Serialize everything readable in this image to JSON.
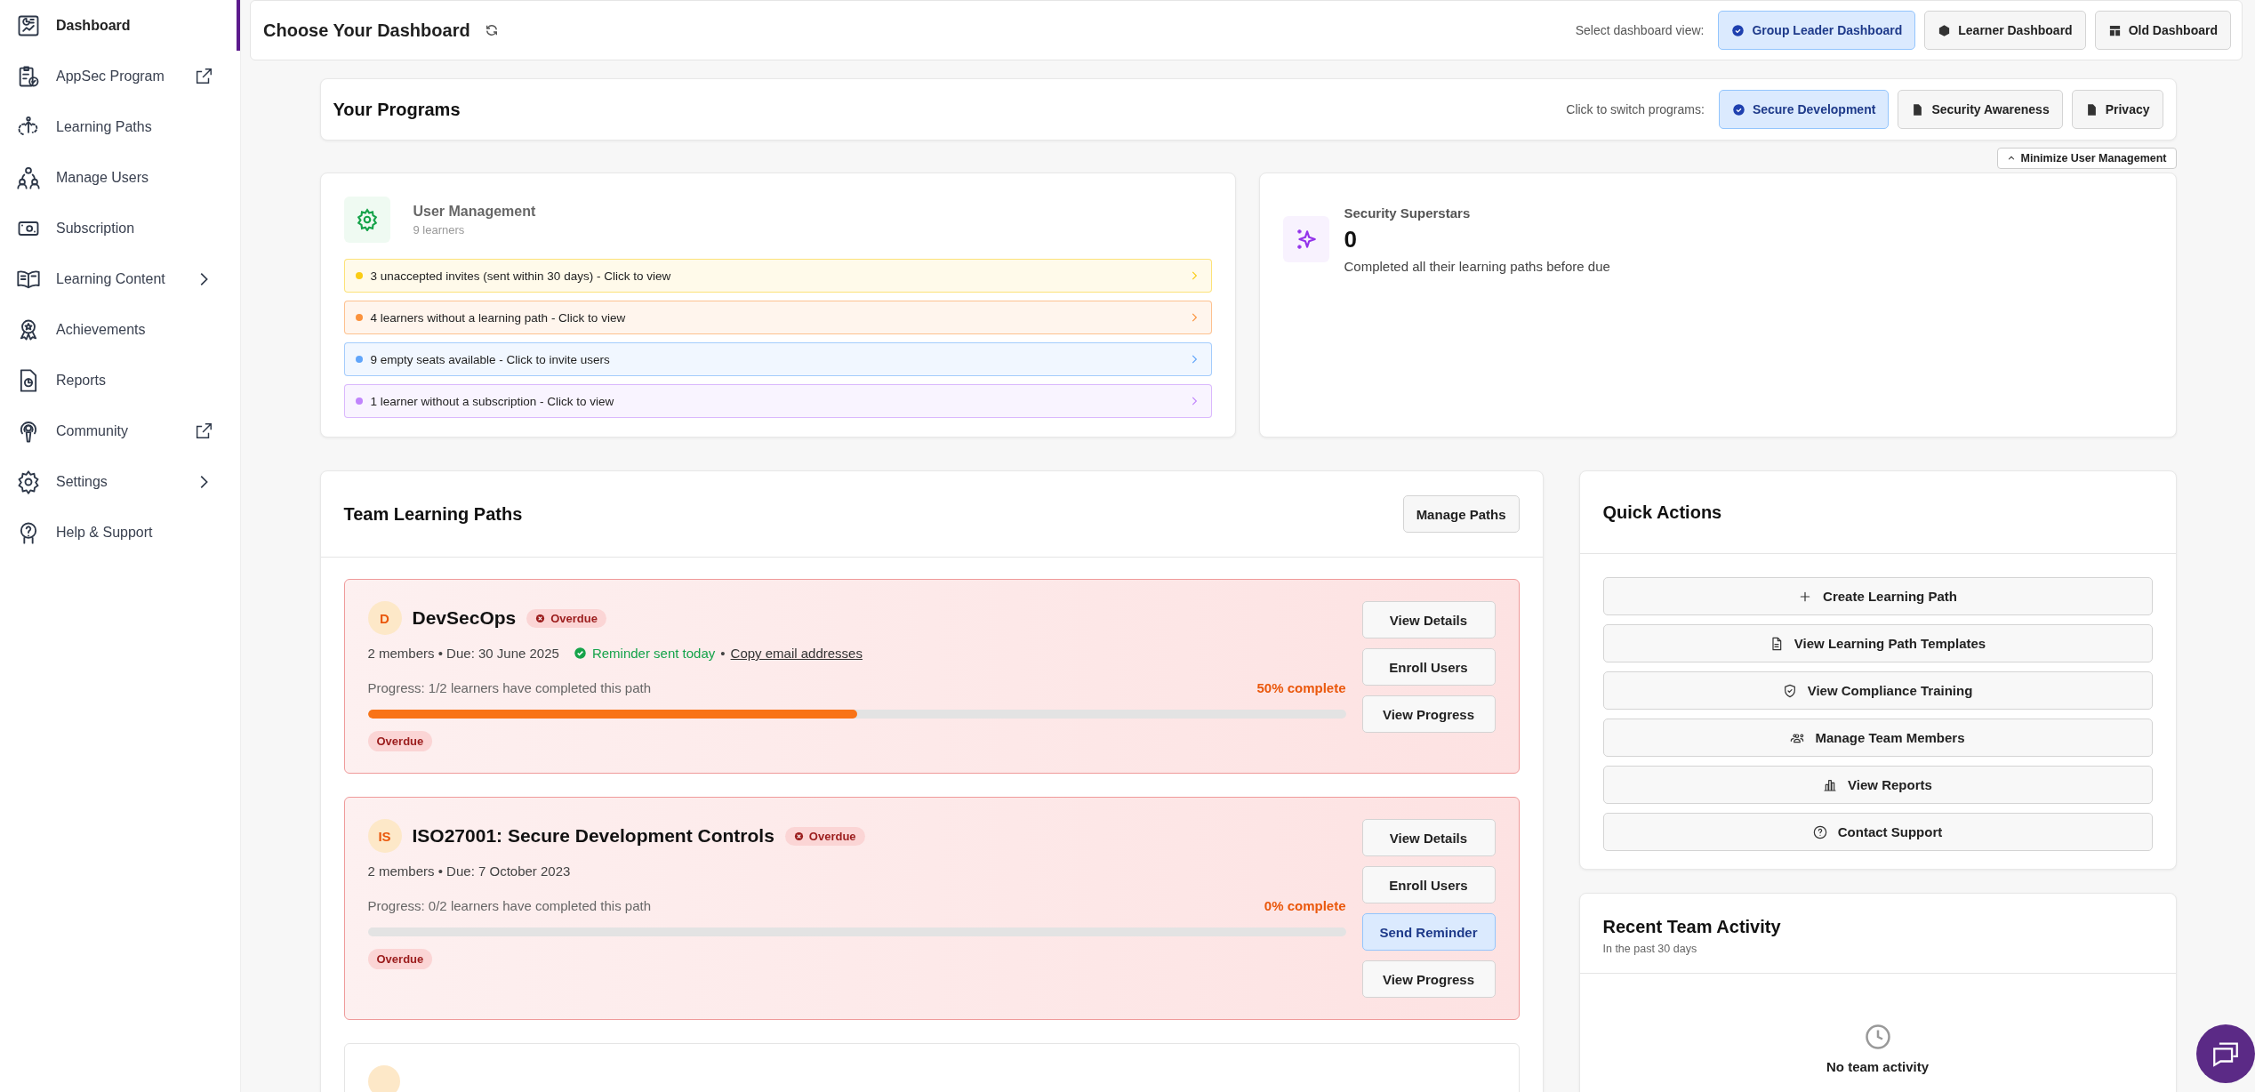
{
  "sidebar": {
    "items": [
      {
        "label": "Dashboard",
        "selected": true
      },
      {
        "label": "AppSec Program",
        "selected": false,
        "kind": "external"
      },
      {
        "label": "Learning Paths",
        "selected": false
      },
      {
        "label": "Manage Users",
        "selected": false
      },
      {
        "label": "Subscription",
        "selected": false
      },
      {
        "label": "Learning Content",
        "selected": false,
        "kind": "submenu"
      },
      {
        "label": "Achievements",
        "selected": false
      },
      {
        "label": "Reports",
        "selected": false
      },
      {
        "label": "Community",
        "selected": false,
        "kind": "external"
      },
      {
        "label": "Settings",
        "selected": false,
        "kind": "submenu"
      },
      {
        "label": "Help & Support",
        "selected": false
      }
    ]
  },
  "header": {
    "title": "Choose Your Dashboard",
    "view_label": "Select dashboard view:",
    "views": [
      {
        "label": "Group Leader Dashboard",
        "selected": true
      },
      {
        "label": "Learner Dashboard",
        "selected": false
      },
      {
        "label": "Old Dashboard",
        "selected": false
      }
    ]
  },
  "programs": {
    "title": "Your Programs",
    "switch_label": "Click to switch programs:",
    "buttons": [
      {
        "label": "Secure Development",
        "selected": true
      },
      {
        "label": "Security Awareness",
        "selected": false
      },
      {
        "label": "Privacy",
        "selected": false
      }
    ]
  },
  "minimize_button": "Minimize User Management",
  "user_management": {
    "title": "User Management",
    "subtitle": "9 learners",
    "alerts": [
      {
        "text": "3 unaccepted invites (sent within 30 days) - Click to view",
        "color": "#facc15"
      },
      {
        "text": "4 learners without a learning path - Click to view",
        "color": "#fb923c"
      },
      {
        "text": "9 empty seats available - Click to invite users",
        "color": "#60a5fa"
      },
      {
        "text": "1 learner without a subscription - Click to view",
        "color": "#c084fc"
      }
    ]
  },
  "superstars": {
    "title": "Security Superstars",
    "value": "0",
    "description": "Completed all their learning paths before due"
  },
  "team_learning_paths": {
    "title": "Team Learning Paths",
    "manage_button": "Manage Paths",
    "paths": [
      {
        "initials": "D",
        "name": "DevSecOps",
        "status": "Overdue",
        "meta": "2 members • Due: 30 June 2025",
        "reminder": "Reminder sent today",
        "separator": "•",
        "link": "Copy email addresses",
        "progress_text": "Progress: 1/2 learners have completed this path",
        "percent_text": "50% complete",
        "level": 0.5,
        "tag": "Overdue",
        "buttons": [
          {
            "label": "View Details",
            "kind": "default"
          },
          {
            "label": "Enroll Users",
            "kind": "default"
          },
          {
            "label": "View Progress",
            "kind": "default"
          }
        ]
      },
      {
        "initials": "IS",
        "name": "ISO27001: Secure Development Controls",
        "status": "Overdue",
        "meta": "2 members • Due: 7 October 2023",
        "progress_text": "Progress: 0/2 learners have completed this path",
        "percent_text": "0% complete",
        "level": 0,
        "tag": "Overdue",
        "buttons": [
          {
            "label": "View Details",
            "kind": "default"
          },
          {
            "label": "Enroll Users",
            "kind": "default"
          },
          {
            "label": "Send Reminder",
            "kind": "primary"
          },
          {
            "label": "View Progress",
            "kind": "default"
          }
        ]
      }
    ]
  },
  "quick_actions": {
    "title": "Quick Actions",
    "actions": [
      {
        "label": "Create Learning Path"
      },
      {
        "label": "View Learning Path Templates"
      },
      {
        "label": "View Compliance Training"
      },
      {
        "label": "Manage Team Members"
      },
      {
        "label": "View Reports"
      },
      {
        "label": "Contact Support"
      }
    ]
  },
  "recent_activity": {
    "title": "Recent Team Activity",
    "subtitle": "In the past 30 days",
    "empty_text": "No team activity"
  }
}
